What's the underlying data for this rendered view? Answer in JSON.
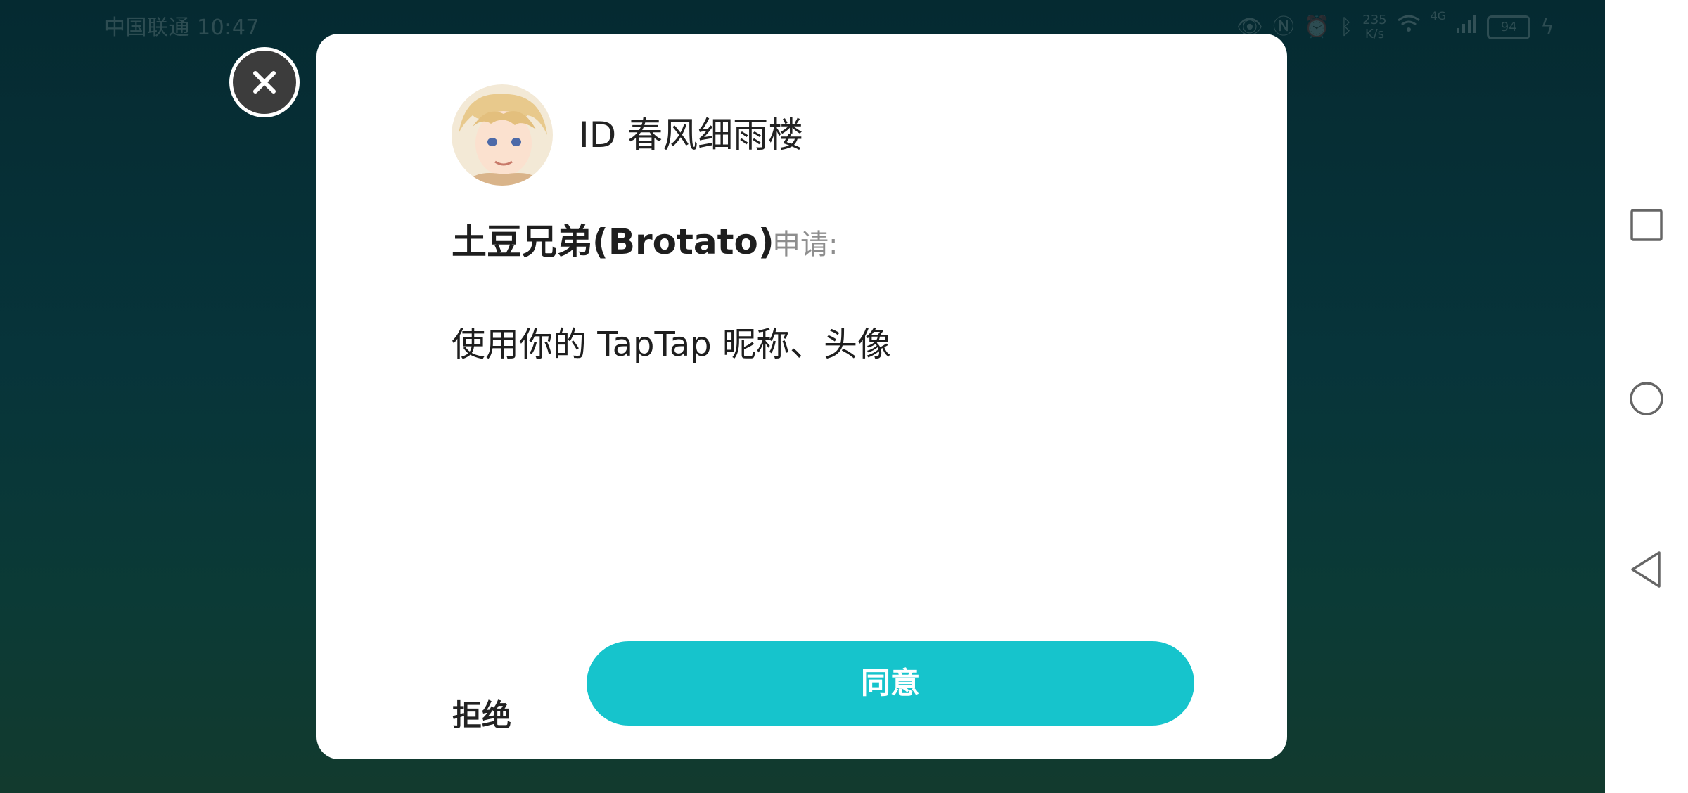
{
  "status_bar": {
    "carrier_time": "中国联通 10:47",
    "network_speed": "235\nK/s",
    "network_type": "4G",
    "battery_level": "94",
    "icons": [
      "eye-icon",
      "nfc-icon",
      "alarm-icon",
      "bluetooth-icon",
      "wifi-icon",
      "signal-icon",
      "battery-icon",
      "charging-icon"
    ]
  },
  "dialog": {
    "user_id": "ID 春风细雨楼",
    "app_name": "土豆兄弟(Brotato)",
    "apply_label": "申请:",
    "permission_text": "使用你的 TapTap 昵称、头像",
    "reject_label": "拒绝",
    "agree_label": "同意"
  },
  "nav": {
    "icons": [
      "recents-square-icon",
      "home-circle-icon",
      "back-triangle-icon"
    ]
  },
  "colors": {
    "accent": "#16c4cc",
    "background_dark": "#062d33",
    "close_button": "#3c3c3c"
  }
}
